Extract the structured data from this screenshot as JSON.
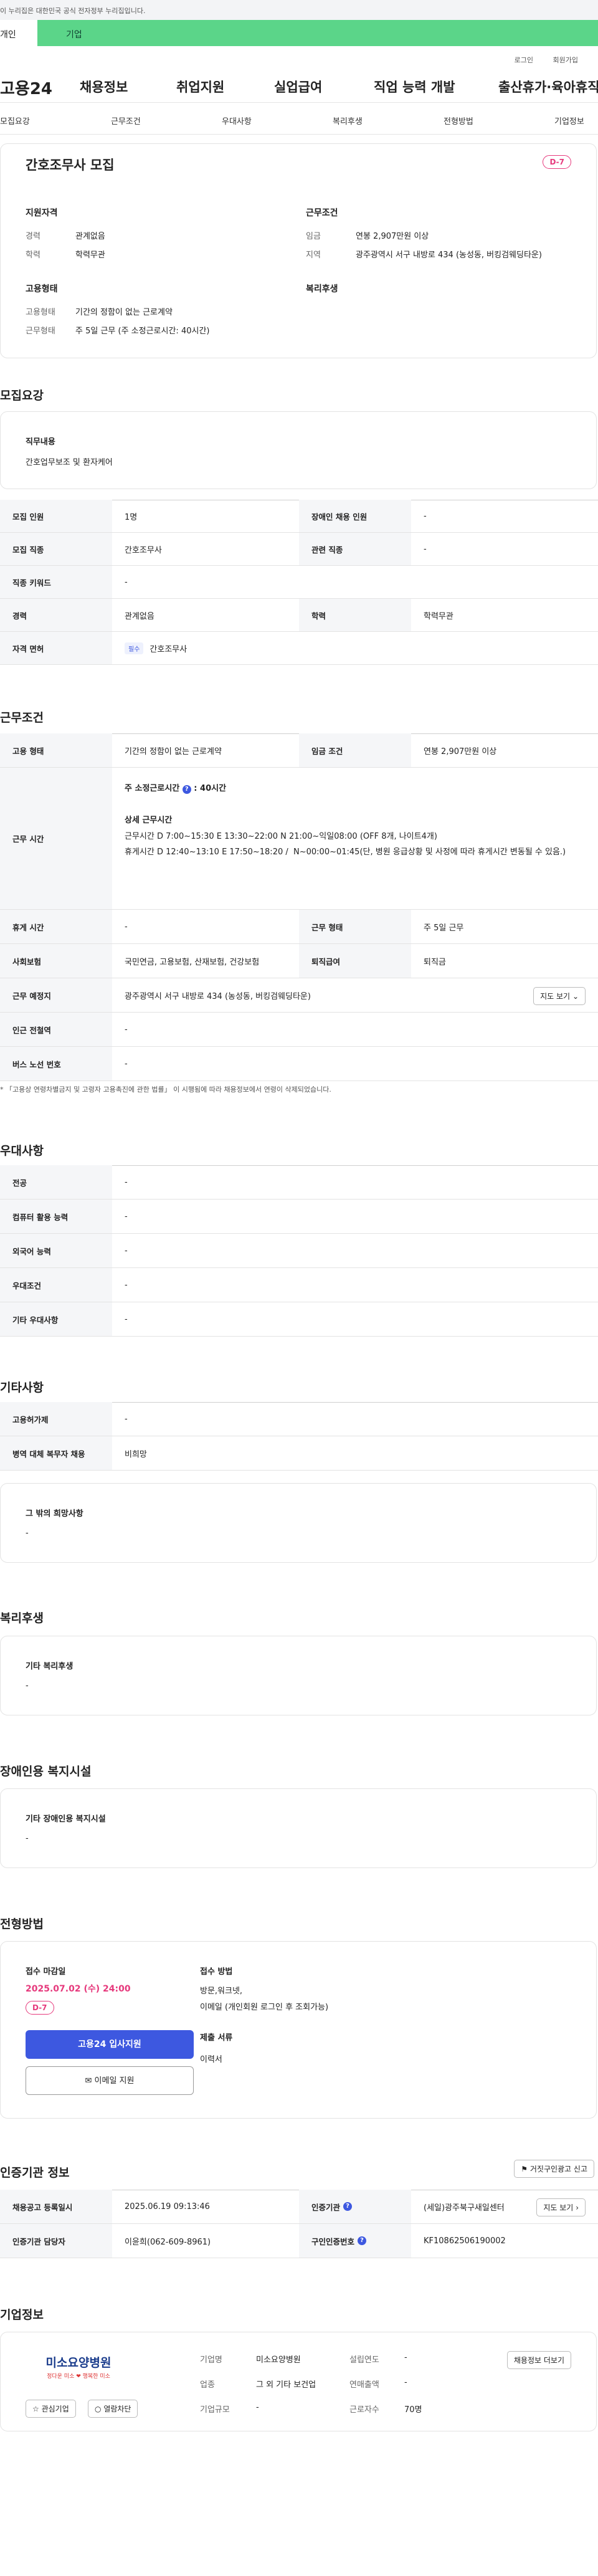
{
  "gov_banner": "이 누리집은 대한민국 공식 전자정부 누리집입니다.",
  "tabs": {
    "personal": "개인",
    "company": "기업"
  },
  "util": {
    "login": "로그인",
    "signup": "회원가입"
  },
  "gnb": {
    "logo": "고용24",
    "menu": [
      "채용정보",
      "취업지원",
      "실업급여",
      "직업 능력 개발",
      "출산휴가·육아휴직"
    ]
  },
  "lnb": [
    "모집요강",
    "근무조건",
    "우대사항",
    "복리후생",
    "전형방법",
    "기업정보"
  ],
  "summary": {
    "title": "간호조무사 모집",
    "dday": "D-7",
    "qual_title": "지원자격",
    "qual": [
      {
        "k": "경력",
        "v": "관계없음"
      },
      {
        "k": "학력",
        "v": "학력무관"
      }
    ],
    "emp_title": "고용형태",
    "emp": [
      {
        "k": "고용형태",
        "v": "기간의 정함이 없는 근로계약"
      },
      {
        "k": "근무형태",
        "v": "주 5일 근무 (주 소정근로시간: 40시간)"
      }
    ],
    "cond_title": "근무조건",
    "cond": [
      {
        "k": "임금",
        "v": "연봉 2,907만원 이상"
      },
      {
        "k": "지역",
        "v": "광주광역시 서구 내방로 434 (농성동, 버킹검웨딩타운)"
      }
    ],
    "welfare_title": "복리후생"
  },
  "recruit": {
    "title": "모집요강",
    "duty_label": "직무내용",
    "duty": "간호업무보조 및 환자케어",
    "rows": [
      [
        "모집 인원",
        "1명",
        "장애인 채용 인원",
        "-"
      ],
      [
        "모집 직종",
        "간호조무사",
        "관련 직종",
        "-"
      ],
      [
        "직종 키워드",
        "-"
      ],
      [
        "경력",
        "관계없음",
        "학력",
        "학력무관"
      ],
      [
        "자격 면허",
        "간호조무사"
      ]
    ],
    "license_tag": "필수"
  },
  "work": {
    "title": "근무조건",
    "type_label": "고용 형태",
    "type": "기간의 정함이 없는 근로계약",
    "wage_label": "임금 조건",
    "wage": "연봉 2,907만원 이상",
    "hours_label": "근무 시간",
    "hours_weekly": "주 소정근로시간",
    "hours_weekly_val": "40시간",
    "hours_detail_title": "상세 근무시간",
    "hours_detail": "근무시간 D 7:00~15:30 E 13:30~22:00 N 21:00~익일08:00 (OFF 8개, 나이트4개)\n휴게시간 D 12:40~13:10 E 17:50~18:20 /  N~00:00~01:45(단, 병원 응급상황 및 사정에 따라 휴게시간 변동될 수 있음.)",
    "rest_label": "휴게 시간",
    "rest": "-",
    "form_label": "근무 형태",
    "form": "주 5일 근무",
    "ins_label": "사회보험",
    "ins": "국민연금, 고용보험, 산재보험, 건강보험",
    "sev_label": "퇴직급여",
    "sev": "퇴직금",
    "place_label": "근무 예정지",
    "place": "광주광역시 서구 내방로 434 (농성동, 버킹검웨딩타운)",
    "map_btn": "지도 보기",
    "station_label": "인근 전철역",
    "station": "-",
    "bus_label": "버스 노선 번호",
    "bus": "-",
    "note": "* 「고용상 연령차별금지 및 고령자 고용촉진에 관한 법률」 이 시행됨에 따라 채용정보에서 연령이 삭제되었습니다."
  },
  "pref": {
    "title": "우대사항",
    "rows": [
      [
        "전공",
        "-"
      ],
      [
        "컴퓨터 활용 능력",
        "-"
      ],
      [
        "외국어 능력",
        "-"
      ],
      [
        "우대조건",
        "-"
      ],
      [
        "기타 우대사항",
        "-"
      ]
    ]
  },
  "etc": {
    "title": "기타사항",
    "rows": [
      [
        "고용허가제",
        "-"
      ],
      [
        "병역 대체 복무자 채용",
        "비희망"
      ]
    ],
    "other_label": "그 밖의 희망사항",
    "other": "-"
  },
  "welfare": {
    "title": "복리후생",
    "label": "기타 복리후생",
    "value": "-"
  },
  "disab": {
    "title": "장애인용 복지시설",
    "label": "기타 장애인용 복지시설",
    "value": "-"
  },
  "select": {
    "title": "전형방법",
    "deadline_label": "접수 마감일",
    "deadline": "2025.07.02 (수) 24:00",
    "dday": "D-7",
    "apply_btn": "고용24 입사지원",
    "email_btn": "이메일 지원",
    "method_label": "접수 방법",
    "method": "방문,워크넷,\n이메일 (개인회원 로그인 후 조회가능)",
    "docs_label": "제출 서류",
    "docs": "이력서"
  },
  "agency": {
    "title": "인증기관 정보",
    "report_btn": "거짓구인광고 신고",
    "reg_label": "채용공고 등록일시",
    "reg": "2025.06.19 09:13:46",
    "org_label": "인증기관",
    "org": "(세일)광주북구새일센터",
    "detail_btn": "지도 보기",
    "mgr_label": "인증기관 담당자",
    "mgr": "이윤희(062-609-8961)",
    "num_label": "구인인증번호",
    "num": "KF10862506190002"
  },
  "company": {
    "title": "기업정보",
    "logo_text": "미소요양병원",
    "logo_sub": "정다운 미소 ❤ 행복한 미소",
    "fav_btn": "관심기업",
    "block_btn": "열람차단",
    "jobs_btn": "채용정보 더보기",
    "fields": [
      [
        "기업명",
        "미소요양병원",
        "설립연도",
        "-"
      ],
      [
        "업종",
        "그 외 기타 보건업",
        "연매출액",
        "-"
      ],
      [
        "기업규모",
        "-",
        "근로자수",
        "70명"
      ]
    ]
  },
  "colors": {
    "accent": "#3d58e0",
    "dday": "#e6397c",
    "tab": "#5bd589"
  }
}
